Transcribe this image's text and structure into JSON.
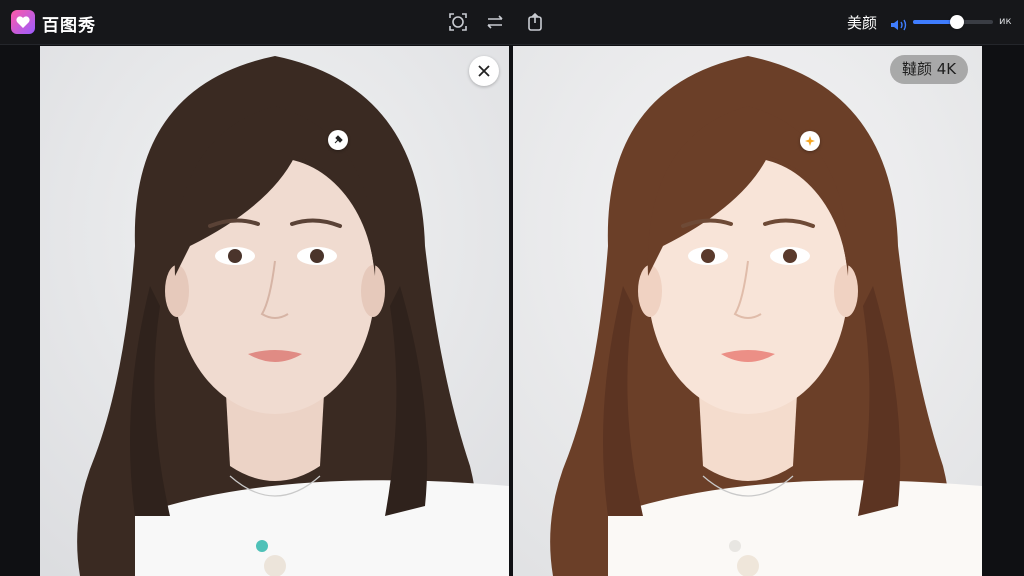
{
  "app": {
    "title": "百图秀"
  },
  "toolbar": {
    "tools": [
      {
        "icon": "crop-face-icon"
      },
      {
        "icon": "compare-swap-icon"
      },
      {
        "icon": "export-share-icon"
      }
    ],
    "beauty_label": "美颜",
    "beauty_level_percent": 55,
    "quality_short": "ик"
  },
  "viewer": {
    "before_marker_icon": "pin-marker-icon",
    "after_marker_icon": "sparkle-marker-icon",
    "after_badge": "韃颜 4K"
  },
  "colors": {
    "accent": "#3f7dff",
    "brand_pink": "#ff5aa8",
    "brand_purple": "#9b5cff"
  }
}
